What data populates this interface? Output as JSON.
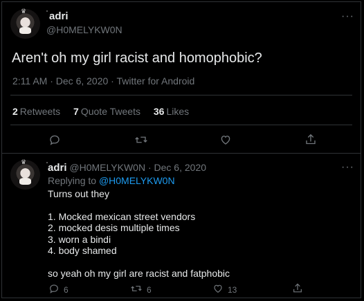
{
  "main_tweet": {
    "display_name": "adri",
    "handle": "@H0MELYKW0N",
    "text": "Aren't oh my girl racist and homophobic?",
    "time": "2:11 AM",
    "date": "Dec 6, 2020",
    "source": "Twitter for Android",
    "retweets_count": "2",
    "retweets_label": "Retweets",
    "quotes_count": "7",
    "quotes_label": "Quote Tweets",
    "likes_count": "36",
    "likes_label": "Likes"
  },
  "reply_tweet": {
    "display_name": "adri",
    "handle": "@H0MELYKW0N",
    "date": "Dec 6, 2020",
    "replying_to_label": "Replying to",
    "replying_to_handle": "@H0MELYKW0N",
    "lines": [
      "Turns out they",
      "1. Mocked mexican street vendors",
      "2. mocked desis multiple times",
      "3. worn a bindi",
      "4. body shamed",
      "so yeah oh my girl are racist and fatphobic"
    ],
    "reply_count": "6",
    "retweet_count": "6",
    "like_count": "13"
  },
  "separator_dot": "·",
  "more_glyph": "···",
  "colors": {
    "accent": "#1d9bf0",
    "muted": "#71767b",
    "text": "#e7e9ea",
    "border": "#2f3336"
  },
  "icons": [
    "reply-icon",
    "retweet-icon",
    "like-icon",
    "share-icon",
    "more-icon"
  ]
}
